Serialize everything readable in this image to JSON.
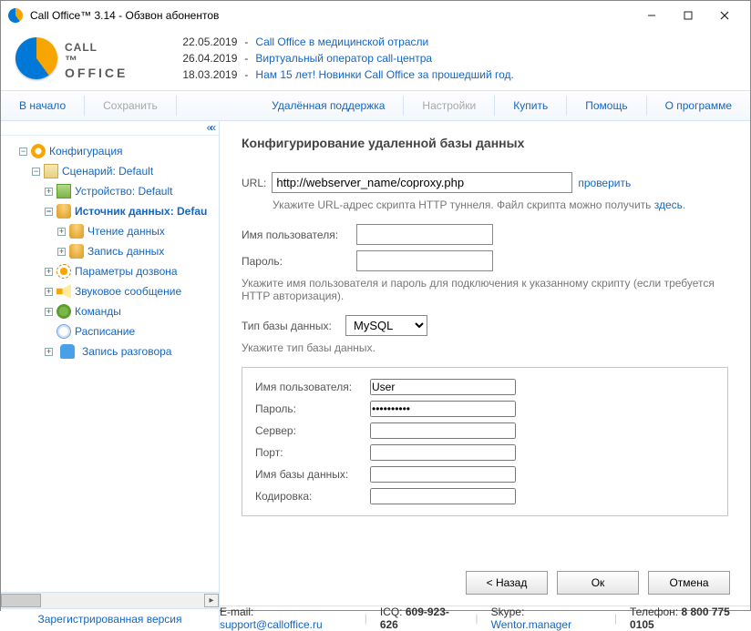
{
  "window": {
    "title": "Call Office™ 3.14 - Обзвон абонентов"
  },
  "logo": {
    "line1": "CALL",
    "line2": "OFFICE"
  },
  "news": [
    {
      "date": "22.05.2019",
      "text": "Call Office в медицинской отрасли"
    },
    {
      "date": "26.04.2019",
      "text": "Виртуальный оператор call-центра"
    },
    {
      "date": "18.03.2019",
      "text": "Нам 15 лет! Новинки Call Office за прошедший год."
    }
  ],
  "toolbar": {
    "home": "В начало",
    "save": "Сохранить",
    "remote": "Удалённая поддержка",
    "settings": "Настройки",
    "buy": "Купить",
    "help": "Помощь",
    "about": "О программе"
  },
  "tree": {
    "config": "Конфигурация",
    "scenario": "Сценарий: Default",
    "device": "Устройство: Default",
    "datasource": "Источник данных: Defau",
    "read": "Чтение данных",
    "write": "Запись данных",
    "dial": "Параметры дозвона",
    "sound": "Звуковое сообщение",
    "cmds": "Команды",
    "sched": "Расписание",
    "rec": "Запись разговора"
  },
  "registered": "Зарегистрированная версия",
  "panel": {
    "title": "Конфигурирование удаленной базы данных",
    "url_label": "URL:",
    "url_value": "http://webserver_name/coproxy.php",
    "check": "проверить",
    "url_hint_a": "Укажите URL-адрес скрипта HTTP туннеля. Файл скрипта можно получить ",
    "url_hint_link": "здесь",
    "user_label": "Имя пользователя:",
    "pass_label": "Пароль:",
    "auth_hint": "Укажите имя пользователя и пароль для подключения к указанному скрипту (если требуется HTTP авторизация).",
    "dbtype_label": "Тип базы данных:",
    "dbtype_value": "MySQL",
    "dbtype_hint": "Укажите тип базы данных.",
    "db_user_label": "Имя пользователя:",
    "db_user_value": "User",
    "db_pass_label": "Пароль:",
    "db_pass_value": "••••••••••",
    "db_server_label": "Сервер:",
    "db_port_label": "Порт:",
    "db_name_label": "Имя базы данных:",
    "db_enc_label": "Кодировка:"
  },
  "buttons": {
    "back": "< Назад",
    "ok": "Ок",
    "cancel": "Отмена"
  },
  "footer": {
    "email_l": "E-mail: ",
    "email": "support@calloffice.ru",
    "icq_l": "ICQ: ",
    "icq": "609-923-626",
    "skype_l": "Skype: ",
    "skype": "Wentor.manager",
    "tel_l": "Телефон: ",
    "tel": "8 800 775 0105"
  }
}
